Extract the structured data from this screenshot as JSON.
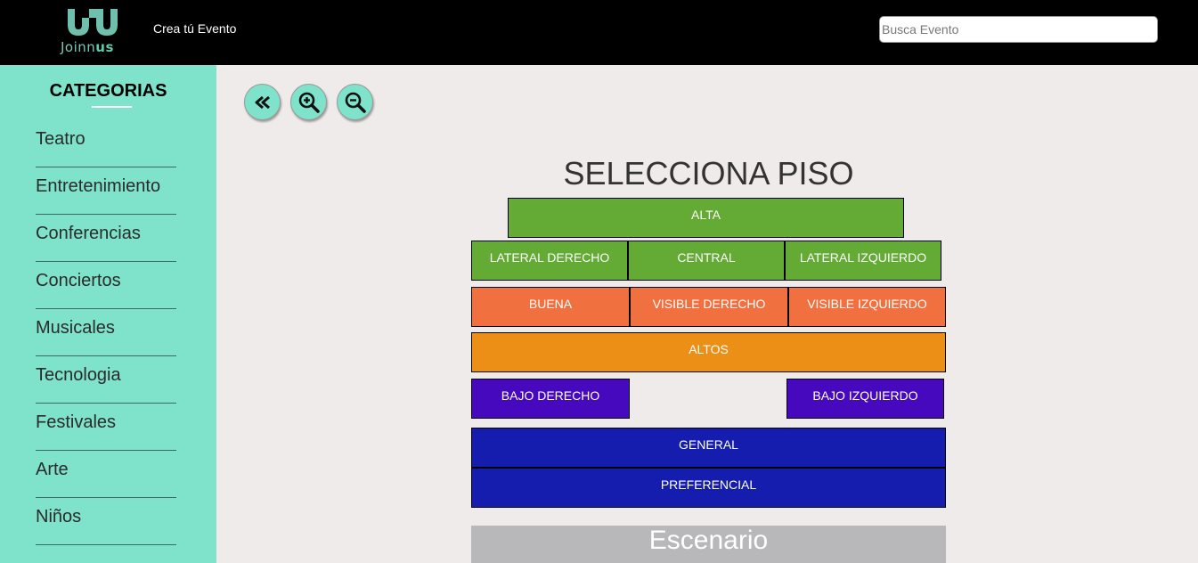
{
  "header": {
    "logo_text_a": "Joinn",
    "logo_text_b": "us",
    "create_event_label": "Crea tú Evento",
    "search_placeholder": "Busca Evento"
  },
  "sidebar": {
    "title": "CATEGORIAS",
    "items": [
      {
        "label": "Teatro"
      },
      {
        "label": "Entretenimiento"
      },
      {
        "label": "Conferencias"
      },
      {
        "label": "Conciertos"
      },
      {
        "label": "Musicales"
      },
      {
        "label": "Tecnologia"
      },
      {
        "label": "Festivales"
      },
      {
        "label": "Arte"
      },
      {
        "label": "Niños"
      }
    ]
  },
  "toolbar": {
    "back_icon": "double-chevron-left-icon",
    "zoom_in_icon": "zoom-in-icon",
    "zoom_out_icon": "zoom-out-icon"
  },
  "map": {
    "heading": "SELECCIONA PISO",
    "zones": {
      "alta": "ALTA",
      "lateral_derecho": "LATERAL DERECHO",
      "central": "CENTRAL",
      "lateral_izquierdo": "LATERAL IZQUIERDO",
      "buena": "BUENA",
      "visible_derecho": "VISIBLE DERECHO",
      "visible_izquierdo": "VISIBLE IZQUIERDO",
      "altos": "ALTOS",
      "bajo_derecho": "BAJO DERECHO",
      "bajo_izquierdo": "BAJO IZQUIERDO",
      "general": "GENERAL",
      "preferencial": "PREFERENCIAL"
    },
    "stage": "Escenario"
  },
  "colors": {
    "accent": "#7ee3ca",
    "green": "#63ab34",
    "coral": "#f07040",
    "orange": "#eb8f16",
    "purple": "#4609be",
    "blue": "#141dae",
    "stage": "#b8b8ba"
  }
}
